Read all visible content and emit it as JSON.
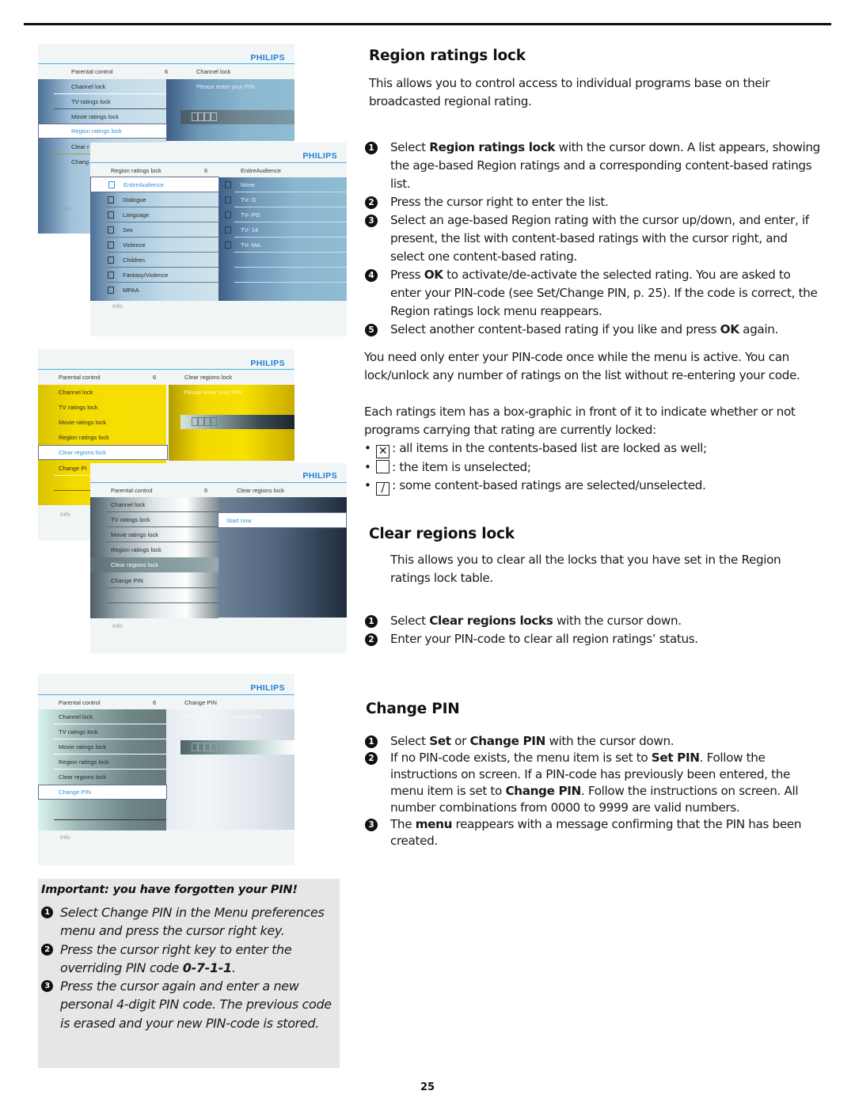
{
  "page_number": "25",
  "tv_brand": "PHILIPS",
  "tv_panels": {
    "region_pin": {
      "header_left": "Parental control",
      "header_num": "6",
      "header_right": "Channel lock",
      "items": [
        "Channel lock",
        "TV ratings lock",
        "Movie ratings lock",
        "Region ratings lock",
        "Clear r",
        "Chang"
      ],
      "selected_index": 3,
      "pin_prompt": "Please enter your PIN",
      "info": "Info"
    },
    "region_list": {
      "header_left": "Region ratings lock",
      "header_num": "6",
      "header_right": "EntireAudience",
      "items": [
        "EntireAudience",
        "Dialogue",
        "Language",
        "Sex",
        "Vielence",
        "Children",
        "Fantasy/Violence",
        "MPAA"
      ],
      "selected_index": 0,
      "right_items": [
        "None",
        "TV- G",
        "TV- PG",
        "TV- 14",
        "TV- MA"
      ],
      "info": "Info"
    },
    "clear_pin": {
      "header_left": "Parental control",
      "header_num": "6",
      "header_right": "Clear regions lock",
      "items": [
        "Channel lock",
        "TV ratings lock",
        "Movie ratings lock",
        "Region ratings lock",
        "Clear regions lock",
        "Change PI"
      ],
      "selected_index": 4,
      "pin_prompt": "Please enter your PIN",
      "info": "Info"
    },
    "clear_start": {
      "header_left": "Parental control",
      "header_num": "6",
      "header_right": "Clear regions lock",
      "items": [
        "Channel lock",
        "TV ratings lock",
        "Movie ratings lock",
        "Region ratings lock",
        "Clear regions lock",
        "Change PIN"
      ],
      "highlighted_index": 4,
      "right_option": "Start now",
      "info": "Info"
    },
    "change_pin": {
      "header_left": "Parental control",
      "header_num": "6",
      "header_right": "Change PIN",
      "items": [
        "Channel lock",
        "TV ratings lock",
        "Movie ratings lock",
        "Region ratings lock",
        "Clear regions lock",
        "Change PIN"
      ],
      "selected_index": 5,
      "pin_prompt": "Please enter your current PIN",
      "info": "Info"
    }
  },
  "region_ratings": {
    "title": "Region ratings lock",
    "intro": "This allows you to control access to individual programs base on their broadcasted regional rating.",
    "steps": [
      {
        "n": "1",
        "pre": "Select ",
        "bold": "Region ratings lock",
        "post": " with the cursor down. A list appears, showing the age-based Region ratings and a corresponding content-based ratings list."
      },
      {
        "n": "2",
        "pre": "Press the cursor right to enter the list.",
        "bold": "",
        "post": ""
      },
      {
        "n": "3",
        "pre": "Select an age-based Region rating with the cursor up/down, and enter, if present, the list with content-based ratings with the cursor right, and select one content-based rating.",
        "bold": "",
        "post": ""
      },
      {
        "n": "4",
        "pre": "Press ",
        "bold": "OK",
        "post": " to activate/de-activate the selected rating. You are asked to enter your PIN-code (see Set/Change PIN, p. 25). If the code is correct, the Region ratings lock menu reappears."
      },
      {
        "n": "5",
        "pre": "Select another content-based rating if you like and press ",
        "bold": "OK",
        "post": " again."
      }
    ],
    "para1": "You need only enter your PIN-code once while the menu is active. You can lock/unlock any number of ratings on the list without re-entering your code.",
    "para2": "Each ratings item has a box-graphic in front of it to indicate whether or not programs carrying that rating are currently locked:",
    "legend": [
      {
        "icon": "checkbox-locked-icon",
        "glyph": "✕",
        "text": ": all items in the contents-based list are locked as well;"
      },
      {
        "icon": "checkbox-empty-icon",
        "glyph": "",
        "text": ": the item is unselected;"
      },
      {
        "icon": "checkbox-partial-icon",
        "glyph": "/",
        "text": ": some content-based ratings are selected/unselected."
      }
    ]
  },
  "clear_regions": {
    "title": "Clear regions lock",
    "intro": "This allows you to clear all the locks that you have set in the Region ratings lock table.",
    "steps": [
      {
        "n": "1",
        "pre": "Select ",
        "bold": "Clear regions locks",
        "post": " with the cursor down."
      },
      {
        "n": "2",
        "pre": "Enter your PIN-code to clear all region ratings’ status.",
        "bold": "",
        "post": ""
      }
    ]
  },
  "change_pin": {
    "title": "Change PIN",
    "steps": [
      {
        "n": "1",
        "parts": [
          [
            "",
            "Select "
          ],
          [
            "b",
            "Set"
          ],
          [
            "",
            " or "
          ],
          [
            "b",
            "Change PIN"
          ],
          [
            "",
            " with the cursor down."
          ]
        ]
      },
      {
        "n": "2",
        "parts": [
          [
            "",
            "If no PIN-code exists, the menu item is set to "
          ],
          [
            "b",
            "Set PIN"
          ],
          [
            "",
            ". Follow the instructions on screen. If a PIN-code has previously been entered, the menu item is set to "
          ],
          [
            "b",
            "Change PIN"
          ],
          [
            "",
            ". Follow the instructions on screen. All number combinations from 0000 to 9999 are valid numbers."
          ]
        ]
      },
      {
        "n": "3",
        "parts": [
          [
            "",
            "The "
          ],
          [
            "b",
            "menu"
          ],
          [
            "",
            " reappears with a message confirming that the PIN has been created."
          ]
        ]
      }
    ]
  },
  "forgotten_pin": {
    "title": "Important: you have forgotten your PIN!",
    "steps": [
      {
        "n": "1",
        "pre": "Select Change PIN in the Menu preferences menu and press the cursor right key.",
        "bold": "",
        "post": ""
      },
      {
        "n": "2",
        "pre": "Press the cursor right key to enter the overriding PIN code ",
        "bold": "0-7-1-1",
        "post": "."
      },
      {
        "n": "3",
        "pre": "Press the cursor again and enter a new personal 4-digit PIN code. The previous code is erased and your new PIN-code is stored.",
        "bold": "",
        "post": ""
      }
    ]
  }
}
